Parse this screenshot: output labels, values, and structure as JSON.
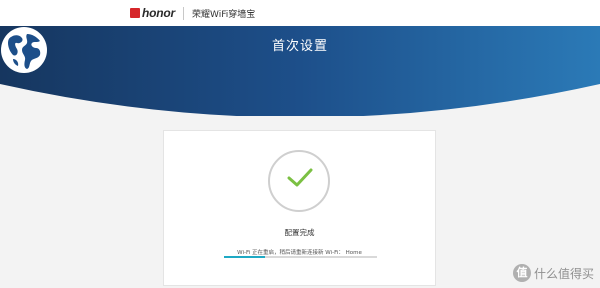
{
  "header": {
    "brand_name": "honor",
    "product_name": "荣耀WiFi穿墙宝"
  },
  "hero": {
    "title": "首次设置",
    "icon": "globe-icon"
  },
  "status": {
    "icon": "check-icon",
    "title": "配置完成",
    "message": "Wi-Fi 正在重启，稍后请重新连接新 Wi-Fi：  Home",
    "progress": 0.27
  },
  "watermark": {
    "text": "什么值得买",
    "icon_text": "值"
  },
  "colors": {
    "banner_dark": "#1a3c6f",
    "banner_light": "#2b7ab7",
    "accent": "#1fa9c4",
    "check": "#7bc043",
    "brand_red": "#d6262a"
  }
}
